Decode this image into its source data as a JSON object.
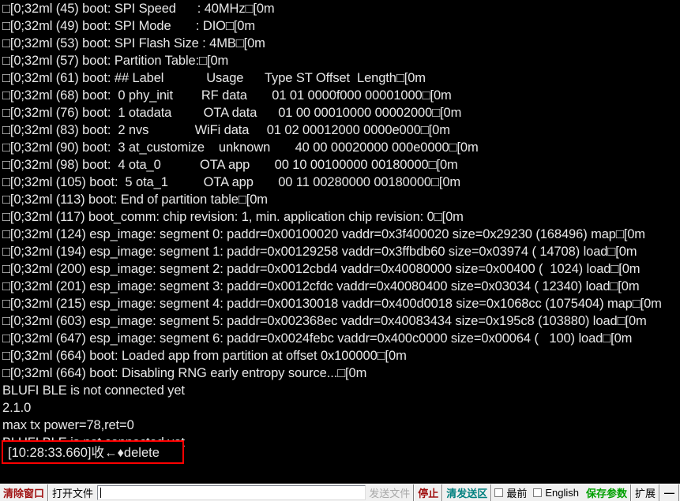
{
  "terminal": {
    "background": "#000000",
    "text_color": "#e8e8e8",
    "lines": [
      "□[0;32ml (45) boot: SPI Speed      : 40MHz□[0m",
      "□[0;32ml (49) boot: SPI Mode       : DIO□[0m",
      "□[0;32ml (53) boot: SPI Flash Size : 4MB□[0m",
      "□[0;32ml (57) boot: Partition Table:□[0m",
      "□[0;32ml (61) boot: ## Label            Usage      Type ST Offset  Length□[0m",
      "□[0;32ml (68) boot:  0 phy_init        RF data       01 01 0000f000 00001000□[0m",
      "□[0;32ml (76) boot:  1 otadata         OTA data      01 00 00010000 00002000□[0m",
      "□[0;32ml (83) boot:  2 nvs             WiFi data     01 02 00012000 0000e000□[0m",
      "□[0;32ml (90) boot:  3 at_customize    unknown       40 00 00020000 000e0000□[0m",
      "□[0;32ml (98) boot:  4 ota_0           OTA app       00 10 00100000 00180000□[0m",
      "□[0;32ml (105) boot:  5 ota_1          OTA app       00 11 00280000 00180000□[0m",
      "□[0;32ml (113) boot: End of partition table□[0m",
      "□[0;32ml (117) boot_comm: chip revision: 1, min. application chip revision: 0□[0m",
      "□[0;32ml (124) esp_image: segment 0: paddr=0x00100020 vaddr=0x3f400020 size=0x29230 (168496) map□[0m",
      "□[0;32ml (194) esp_image: segment 1: paddr=0x00129258 vaddr=0x3ffbdb60 size=0x03974 ( 14708) load□[0m",
      "□[0;32ml (200) esp_image: segment 2: paddr=0x0012cbd4 vaddr=0x40080000 size=0x00400 (  1024) load□[0m",
      "□[0;32ml (201) esp_image: segment 3: paddr=0x0012cfdc vaddr=0x40080400 size=0x03034 ( 12340) load□[0m",
      "□[0;32ml (215) esp_image: segment 4: paddr=0x00130018 vaddr=0x400d0018 size=0x1068cc (1075404) map□[0m",
      "□[0;32ml (603) esp_image: segment 5: paddr=0x002368ec vaddr=0x40083434 size=0x195c8 (103880) load□[0m",
      "□[0;32ml (647) esp_image: segment 6: paddr=0x0024febc vaddr=0x400c0000 size=0x00064 (   100) load□[0m",
      "□[0;32ml (664) boot: Loaded app from partition at offset 0x100000□[0m",
      "□[0;32ml (664) boot: Disabling RNG early entropy source...□[0m",
      "BLUFI BLE is not connected yet",
      "2.1.0",
      "max tx power=78,ret=0",
      "BLUFI BLE is not connected yet",
      "",
      ""
    ],
    "highlight": {
      "text": "[10:28:33.660]收←♦delete",
      "border_color": "#ff0000"
    }
  },
  "toolbar": {
    "clear_window_label": "清除窗口",
    "clear_window_color": "#a01010",
    "open_file_label": "打开文件",
    "file_path_value": "",
    "file_path_placeholder": "",
    "send_file_label": "发送文件",
    "send_file_color": "#a8a8a8",
    "stop_label": "停止",
    "stop_color": "#a01010",
    "clear_send_label": "清发送区",
    "clear_send_color": "#00807f",
    "topmost_label": "最前",
    "topmost_checked": false,
    "english_label": "English",
    "english_checked": false,
    "save_params_label": "保存参数",
    "save_params_color": "#00a000",
    "extend_label": "扩展",
    "minimize_label": "—"
  }
}
